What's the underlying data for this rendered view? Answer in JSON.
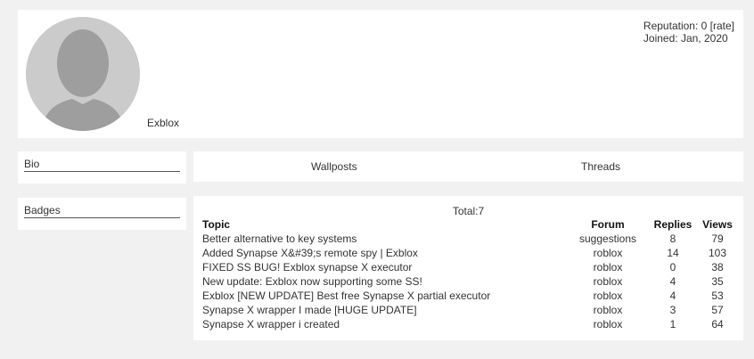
{
  "profile": {
    "username": "Exblox",
    "reputation_text": "Reputation: 0 [rate]",
    "joined_text": "Joined: Jan, 2020"
  },
  "sidebar": {
    "bio_label": "Bio",
    "badges_label": "Badges"
  },
  "tabs": {
    "wallposts_label": "Wallposts",
    "threads_label": "Threads"
  },
  "threads": {
    "total_text": "Total:7",
    "headers": {
      "topic": "Topic",
      "forum": "Forum",
      "replies": "Replies",
      "views": "Views"
    },
    "rows": [
      {
        "topic": "Better alternative to key systems",
        "forum": "suggestions",
        "replies": "8",
        "views": "79"
      },
      {
        "topic": "Added Synapse X&#39;s remote spy | Exblox",
        "forum": "roblox",
        "replies": "14",
        "views": "103"
      },
      {
        "topic": "FIXED SS BUG! Exblox synapse X executor",
        "forum": "roblox",
        "replies": "0",
        "views": "38"
      },
      {
        "topic": "New update: Exblox now supporting some SS!",
        "forum": "roblox",
        "replies": "4",
        "views": "35"
      },
      {
        "topic": "Exblox [NEW UPDATE] Best free Synapse X partial executor",
        "forum": "roblox",
        "replies": "4",
        "views": "53"
      },
      {
        "topic": "Synapse X wrapper I made [HUGE UPDATE]",
        "forum": "roblox",
        "replies": "3",
        "views": "57"
      },
      {
        "topic": "Synapse X wrapper i created",
        "forum": "roblox",
        "replies": "1",
        "views": "64"
      }
    ]
  }
}
